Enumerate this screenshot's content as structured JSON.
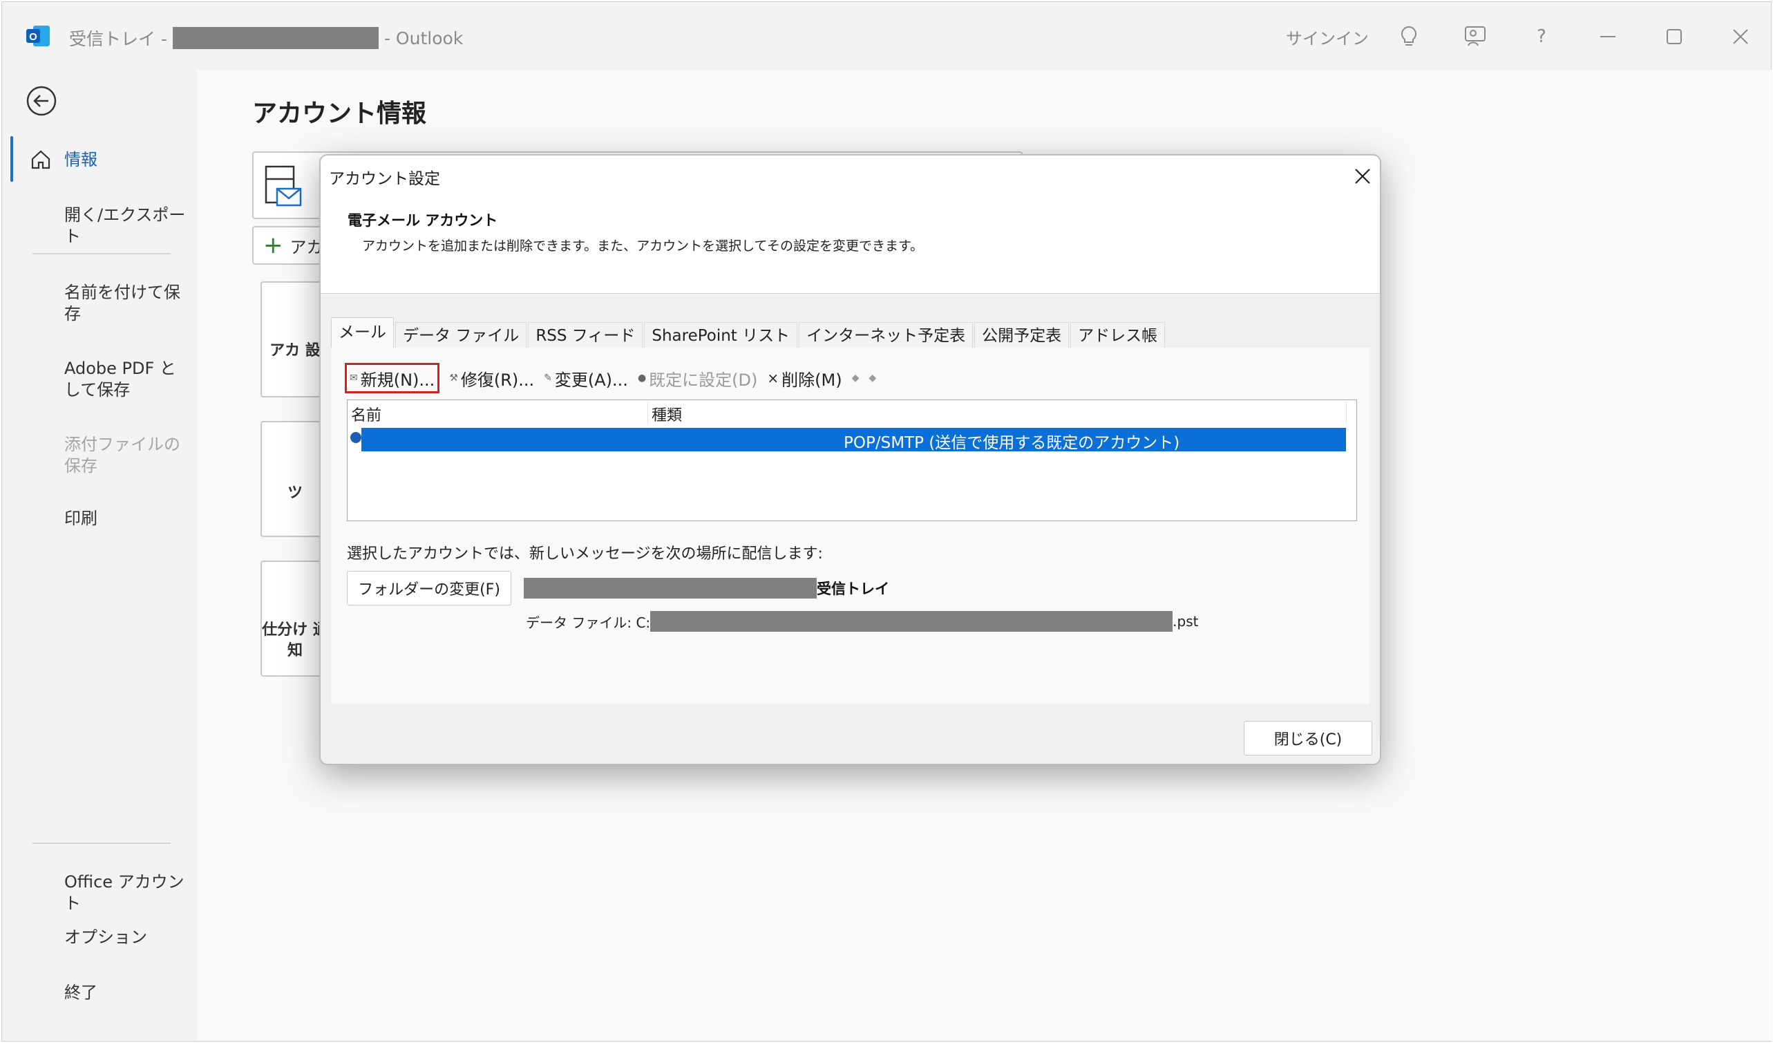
{
  "titlebar": {
    "prefix": "受信トレイ -",
    "suffix": "-  Outlook",
    "signin": "サインイン"
  },
  "nav": {
    "info": "情報",
    "open_export": "開く/エクスポート",
    "save_as": "名前を付けて保存",
    "save_pdf": "Adobe PDF として保存",
    "save_attachments": "添付ファイルの保存",
    "print": "印刷",
    "office_account": "Office アカウント",
    "options": "オプション",
    "exit": "終了"
  },
  "main": {
    "title": "アカウント情報",
    "add_account": "アカ",
    "tile1": "アカ 設",
    "tile2": "ツ",
    "tile3": "仕分け 通知"
  },
  "dialog": {
    "title": "アカウント設定",
    "heading": "電子メール アカウント",
    "description": "アカウントを追加または削除できます。また、アカウントを選択してその設定を変更できます。",
    "tabs": [
      "メール",
      "データ ファイル",
      "RSS フィード",
      "SharePoint リスト",
      "インターネット予定表",
      "公開予定表",
      "アドレス帳"
    ],
    "toolbar": {
      "new": "新規(N)...",
      "repair": "修復(R)...",
      "change": "変更(A)...",
      "set_default": "既定に設定(D)",
      "delete": "削除(M)"
    },
    "list": {
      "col_name": "名前",
      "col_type": "種類",
      "row_type": "POP/SMTP (送信で使用する既定のアカウント)"
    },
    "deliver_text": "選択したアカウントでは、新しいメッセージを次の場所に配信します:",
    "change_folder": "フォルダーの変更(F)",
    "inbox_label": "受信トレイ",
    "data_file_prefix": "データ ファイル: C:",
    "data_file_suffix": ".pst",
    "close": "閉じる(C)"
  },
  "colors": {
    "accent": "#1a6fc7",
    "selection": "#0a6fd6",
    "highlight_border": "#d21f1f"
  }
}
